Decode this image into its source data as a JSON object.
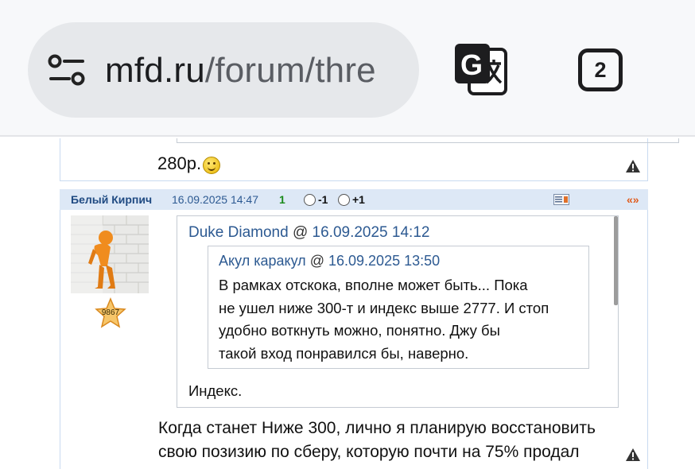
{
  "browser": {
    "url_domain": "mfd.ru",
    "url_path": "/forum/thre",
    "tab_count": "2",
    "site_icon": "tune-icon",
    "translate_icon": "translate-icon"
  },
  "prev_post": {
    "text": "280р.",
    "smiley_icon": "smiley-icon"
  },
  "post": {
    "author": "Белый Кирпич",
    "datetime": "16.09.2025 14:47",
    "rating": "1",
    "vote_minus": "-1",
    "vote_plus": "+1",
    "quote_link": "«»",
    "star_count": "9867",
    "quote": {
      "author": "Duke Diamond",
      "at": "@",
      "datetime": "16.09.2025 14:12",
      "nested": {
        "author": "Акул каракул",
        "at": "@",
        "datetime": "16.09.2025 13:50",
        "lines": [
          "В рамках отскока, вполне может быть... Пока",
          "не ушел ниже 300-т и индекс выше 2777. И стоп",
          "удобно воткнуть можно, понятно. Джу бы",
          "такой вход понравился бы, наверно."
        ]
      },
      "text": "Индекс."
    },
    "text_lines": [
      "Когда станет Ниже 300, лично я планирую восстановить",
      "свою позизию по сберу, которую почти на 75% продал"
    ]
  },
  "colors": {
    "header_bg": "#dde8f6",
    "link_blue": "#2d5a92",
    "author_blue": "#1f4a82",
    "rating_green": "#1a8a1a",
    "quote_link_orange": "#e05a1a"
  }
}
